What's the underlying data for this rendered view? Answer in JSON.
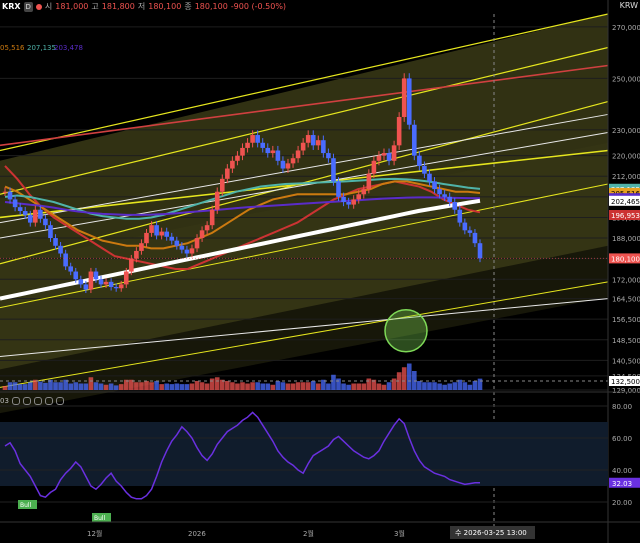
{
  "header": {
    "symbol": "KRX",
    "interval_badge": "D",
    "open_label": "시",
    "open": "181,000",
    "high_label": "고",
    "high": "181,800",
    "low_label": "저",
    "low": "180,100",
    "close_label": "종",
    "close": "180,100",
    "change": "-900 (-0.50%)",
    "left_price_tags": [
      "05,516",
      "207,135",
      "203,478"
    ]
  },
  "currency": "KRW",
  "oscillator_id": "03",
  "colors": {
    "background": "#000000",
    "channel_fill": "#3a3a16",
    "channel_line": "#e6e61e",
    "up_candle": "#ef5350",
    "down_candle": "#4a6cff",
    "ma_red": "#cc3333",
    "ma_orange": "#cc7a10",
    "ma_teal": "#4fb3a9",
    "ma_purple": "#5a2cc8",
    "ma_white": "#ffffff",
    "oscillator": "#6a30e0",
    "highlight_circle": "#7ed957"
  },
  "chart_data": [
    {
      "type": "line",
      "title": "",
      "y_axis": {
        "ticks": [
          "270,000",
          "250,000",
          "230,000",
          "220,000",
          "212,000",
          "204,000",
          "196,000",
          "188,000",
          "180,000",
          "172,000",
          "164,500",
          "156,500",
          "148,500",
          "140,500",
          "134,500",
          "129,000"
        ],
        "range": [
          129000,
          275000
        ]
      },
      "x_axis": {
        "labels": [
          "12월",
          "2026",
          "2월",
          "3월"
        ],
        "crosshair_label": "수 2026-03-25  13:00"
      },
      "price_tags": [
        {
          "value": "207,135",
          "color": "#4fb3a9"
        },
        {
          "value": "205,516",
          "color": "#e6a020"
        },
        {
          "value": "203,478",
          "color": "#5a2cc8"
        },
        {
          "value": "202,465",
          "color": "#ffffff"
        },
        {
          "value": "196,953",
          "color": "#cc3333"
        },
        {
          "value": "180,100",
          "color": "#ef5350"
        },
        {
          "value": "132,500",
          "color": "#ffffff"
        }
      ],
      "last_close": 180100,
      "candles_close": [
        206000,
        203000,
        200000,
        198500,
        197000,
        194000,
        199000,
        195500,
        193000,
        188000,
        185000,
        182000,
        177000,
        175000,
        172000,
        170000,
        168000,
        175000,
        172000,
        170000,
        171000,
        169000,
        168500,
        170000,
        175000,
        180000,
        183000,
        186000,
        190000,
        193000,
        189000,
        190500,
        188500,
        187000,
        185000,
        183500,
        182000,
        184000,
        188000,
        191000,
        193000,
        199000,
        206000,
        211000,
        215000,
        218000,
        220000,
        223000,
        225000,
        228000,
        225000,
        223000,
        221000,
        222000,
        218000,
        215000,
        217000,
        219000,
        222000,
        225000,
        228000,
        224000,
        226000,
        221000,
        219000,
        210000,
        204000,
        202000,
        201000,
        203000,
        205000,
        207000,
        213000,
        218000,
        220000,
        221000,
        218000,
        224000,
        235000,
        250000,
        232000,
        220000,
        216000,
        213000,
        210000,
        207000,
        205000,
        204000,
        202000,
        199000,
        194000,
        191000,
        190000,
        186000,
        180100
      ],
      "series": [
        {
          "name": "",
          "color": "#cc3333",
          "values": [
            216000,
            211000,
            205000,
            200000,
            196000,
            193000,
            190000,
            187000,
            184000,
            181000,
            180000,
            179000,
            178000,
            177000,
            176000,
            176000,
            178000,
            180000,
            182000,
            184000,
            186000,
            188000,
            190000,
            192000,
            194000,
            197000,
            200000,
            203000,
            205000,
            207000,
            208000,
            209000,
            210000,
            209000,
            208000,
            206000,
            203000,
            201000,
            199000,
            198000
          ]
        },
        {
          "name": "",
          "color": "#cc7a10",
          "values": [
            208000,
            206000,
            203000,
            200000,
            197000,
            194000,
            191000,
            189000,
            187000,
            186000,
            185000,
            185000,
            184000,
            184000,
            185000,
            186000,
            188000,
            190000,
            193000,
            196000,
            199000,
            201000,
            203000,
            204000,
            205000,
            205000,
            205000,
            205000,
            205000,
            206000,
            207000,
            209000,
            210000,
            210000,
            209000,
            208000,
            207000,
            206000,
            206000,
            205500
          ]
        },
        {
          "name": "",
          "color": "#4fb3a9",
          "values": [
            204000,
            204500,
            204000,
            203000,
            202000,
            200500,
            199000,
            197500,
            196500,
            196000,
            195500,
            195500,
            196000,
            197000,
            198500,
            200000,
            201500,
            203000,
            204500,
            206000,
            207000,
            208000,
            208500,
            209000,
            209200,
            209400,
            209600,
            209800,
            210000,
            210300,
            210600,
            210900,
            211000,
            210800,
            210400,
            209800,
            209000,
            208300,
            207600,
            207100
          ]
        },
        {
          "name": "",
          "color": "#5a2cc8",
          "values": [
            202000,
            201500,
            201000,
            200500,
            199800,
            199000,
            198300,
            197800,
            197400,
            197200,
            197000,
            197000,
            197100,
            197300,
            197600,
            198000,
            198400,
            198800,
            199200,
            199600,
            200000,
            200300,
            200600,
            200900,
            201200,
            201500,
            201800,
            202100,
            202400,
            202700,
            203000,
            203300,
            203500,
            203700,
            203800,
            203800,
            203700,
            203600,
            203500,
            203478
          ]
        },
        {
          "name": "",
          "color": "#ffffff",
          "values": [
            164500,
            165500,
            166500,
            167500,
            168500,
            169500,
            170500,
            171500,
            172500,
            173500,
            174500,
            175500,
            176500,
            177500,
            178500,
            179500,
            180500,
            181500,
            182500,
            183500,
            184500,
            185500,
            186500,
            187500,
            188500,
            189500,
            190500,
            191500,
            192500,
            193500,
            194500,
            195500,
            196500,
            197500,
            198500,
            199300,
            200100,
            200900,
            201700,
            202465
          ]
        }
      ]
    },
    {
      "type": "line",
      "title": "",
      "y_axis": {
        "ticks": [
          "80.00",
          "60.00",
          "40.00",
          "20.00"
        ],
        "range": [
          15,
          85
        ]
      },
      "last_value": "32.03",
      "markers": [
        "Bull",
        "Bull"
      ],
      "series": [
        {
          "name": "",
          "color": "#6a30e0",
          "values": [
            55,
            57,
            52,
            44,
            40,
            36,
            30,
            24,
            23,
            26,
            28,
            34,
            38,
            41,
            45,
            42,
            36,
            30,
            28,
            31,
            35,
            38,
            33,
            30,
            26,
            23,
            22,
            22,
            24,
            28,
            36,
            45,
            52,
            58,
            62,
            67,
            64,
            60,
            54,
            49,
            46,
            50,
            56,
            60,
            64,
            66,
            68,
            71,
            73,
            76,
            73,
            68,
            63,
            58,
            52,
            48,
            45,
            43,
            40,
            38,
            44,
            49,
            51,
            53,
            55,
            59,
            61,
            58,
            55,
            52,
            50,
            48,
            47,
            49,
            52,
            58,
            63,
            68,
            72,
            69,
            60,
            52,
            46,
            42,
            40,
            38,
            37,
            36,
            34,
            33,
            32,
            31,
            31.5,
            32,
            32.03
          ]
        }
      ]
    }
  ]
}
